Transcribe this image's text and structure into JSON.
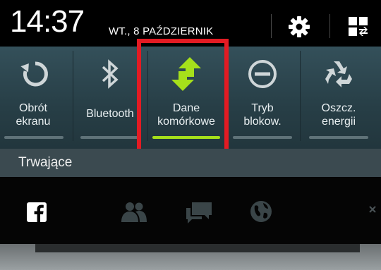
{
  "status": {
    "time": "14:37",
    "date": "WT., 8 PAŹDZIERNIK"
  },
  "header_icons": [
    "settings-gear-icon",
    "grid-toggle-icon"
  ],
  "quick_settings": [
    {
      "label_line1": "Obrót",
      "label_line2": "ekranu",
      "icon": "rotate-icon",
      "active": false
    },
    {
      "label_line1": "",
      "label_line2": "Bluetooth",
      "icon": "bluetooth-icon",
      "active": false
    },
    {
      "label_line1": "Dane",
      "label_line2": "komórkowe",
      "icon": "mobile-data-arrows-icon",
      "active": true
    },
    {
      "label_line1": "Tryb",
      "label_line2": "blokow.",
      "icon": "block-mode-icon",
      "active": false
    },
    {
      "label_line1": "Oszcz.",
      "label_line2": "energii",
      "icon": "recycle-power-saving-icon",
      "active": false
    }
  ],
  "ongoing": {
    "title": "Trwające"
  },
  "notification_icons": [
    "facebook-icon",
    "friends-icon",
    "chat-icon",
    "globe-icon",
    "close-icon"
  ],
  "colors": {
    "active_accent": "#a6e01b",
    "highlight": "#e31b23",
    "panel": "#2b434b"
  }
}
